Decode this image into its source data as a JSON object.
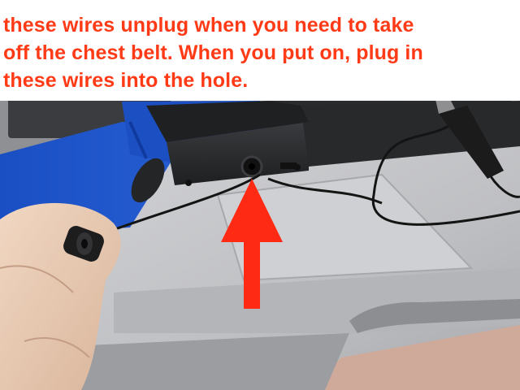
{
  "caption": {
    "line1": "these wires unplug when you need to take",
    "line2": "off the chest belt. When you put on, plug in",
    "line3": "these wires into the hole."
  },
  "colors": {
    "caption_text": "#ff3b17",
    "arrow": "#ff2a14",
    "strap": "#1f57c8",
    "laptop": "#c3c4c7",
    "case": "#2b2c2e"
  },
  "icons": {
    "arrow": "red-up-arrow"
  }
}
